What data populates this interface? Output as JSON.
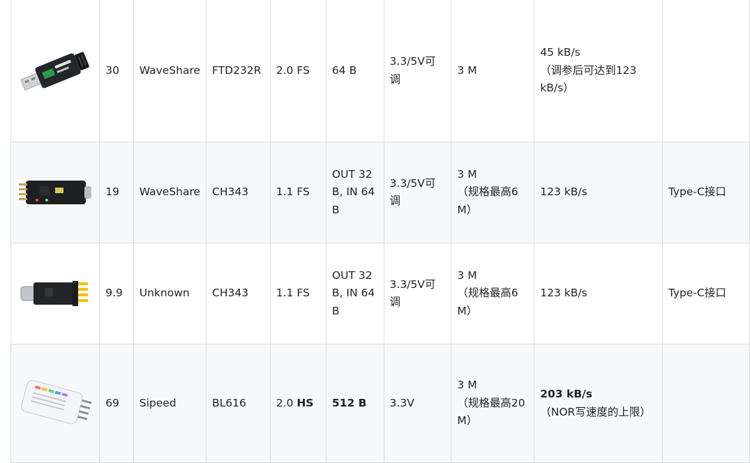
{
  "rows": [
    {
      "image": "usb-ttl-adapter-ftdi-black",
      "price": "30",
      "brand": "WaveShare",
      "chip": "FTD232R",
      "usb": {
        "version": "2.0",
        "speed": "FS"
      },
      "buffer": {
        "line1": "64 B",
        "line2": "",
        "line3": ""
      },
      "voltage": "3.3/5V可调",
      "baud": {
        "line1": "3 M",
        "line2": "",
        "line3": ""
      },
      "throughput": {
        "line1": "45 kB/s",
        "line2": "（调参后可达到123",
        "line3": "kB/s）"
      },
      "note": ""
    },
    {
      "image": "usb-ttl-adapter-ch343-typec",
      "price": "19",
      "brand": "WaveShare",
      "chip": "CH343",
      "usb": {
        "version": "1.1",
        "speed": "FS"
      },
      "buffer": {
        "line1": "OUT 32",
        "line2": "B, IN 64",
        "line3": "B"
      },
      "voltage": "3.3/5V可调",
      "baud": {
        "line1": "3 M",
        "line2": "（规格最高6",
        "line3": "M）"
      },
      "throughput": {
        "line1": "123 kB/s",
        "line2": "",
        "line3": ""
      },
      "note": "Type-C接口"
    },
    {
      "image": "usb-ttl-adapter-ch343-unknown",
      "price": "9.9",
      "brand": "Unknown",
      "chip": "CH343",
      "usb": {
        "version": "1.1",
        "speed": "FS"
      },
      "buffer": {
        "line1": "OUT 32",
        "line2": "B, IN 64",
        "line3": "B"
      },
      "voltage": "3.3/5V可调",
      "baud": {
        "line1": "3 M",
        "line2": "（规格最高6",
        "line3": "M）"
      },
      "throughput": {
        "line1": "123 kB/s",
        "line2": "",
        "line3": ""
      },
      "note": "Type-C接口"
    },
    {
      "image": "usb-debugger-sipeed-white",
      "price": "69",
      "brand": "Sipeed",
      "chip": "BL616",
      "usb": {
        "version": "2.0",
        "speed": "HS"
      },
      "buffer": {
        "line1": "512 B",
        "line2": "",
        "line3": ""
      },
      "voltage": "3.3V",
      "baud": {
        "line1": "3 M",
        "line2": "（规格最高20",
        "line3": "M）"
      },
      "throughput": {
        "line1": "203 kB/s",
        "line2": "（NOR写速度的上限）",
        "line3": ""
      },
      "note": ""
    }
  ]
}
